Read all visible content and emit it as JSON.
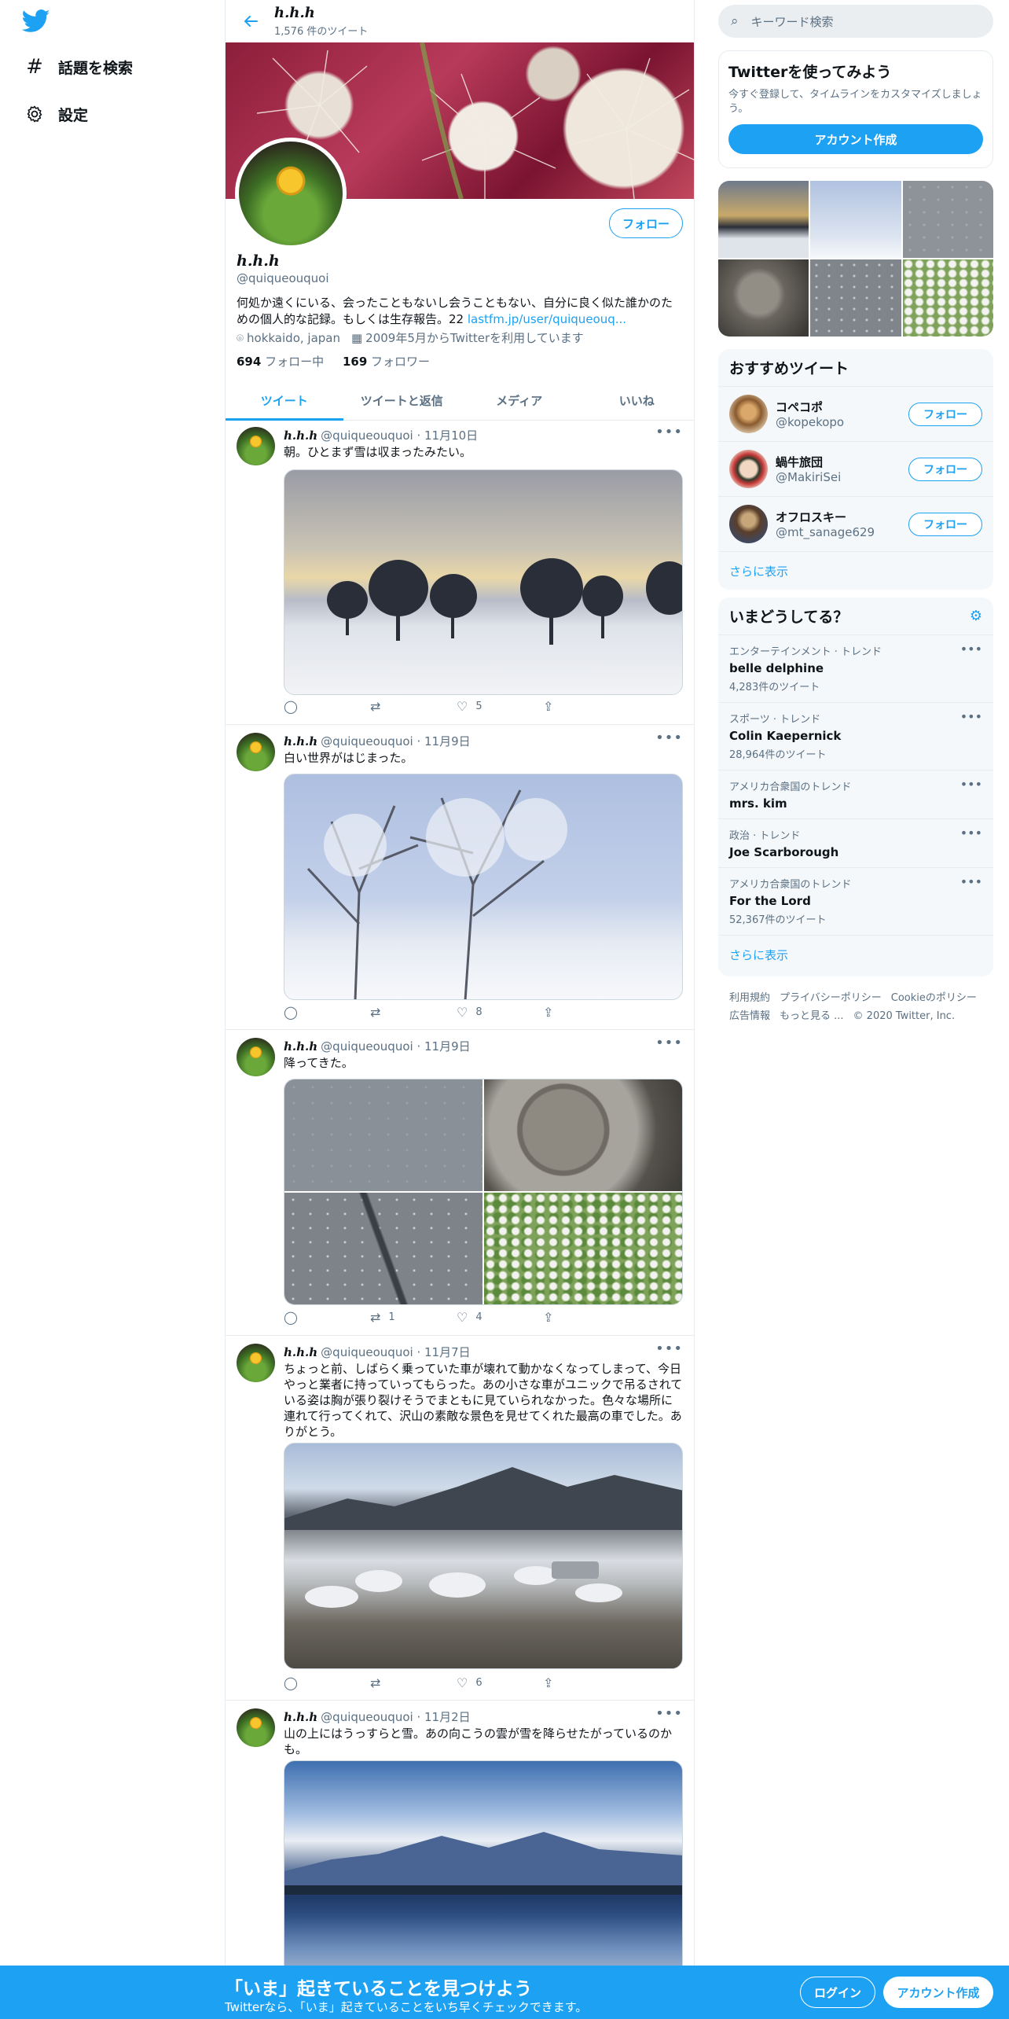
{
  "nav": {
    "explore_label": "話題を検索",
    "settings_label": "設定"
  },
  "header": {
    "name": "ℎ.ℎ.ℎ",
    "tweet_count": "1,576 件のツイート"
  },
  "profile": {
    "name": "ℎ.ℎ.ℎ",
    "handle": "@quiqueouquoi",
    "follow_label": "フォロー",
    "bio": "何処か遠くにいる、会ったこともないし会うこともない、自分に良く似た誰かのための個人的な記録。もしくは生存報告。22 ",
    "bio_link": "lastfm.jp/user/quiqueouq...",
    "location": "hokkaido, japan",
    "joined": "2009年5月からTwitterを利用しています",
    "following_count": "694",
    "following_label": "フォロー中",
    "followers_count": "169",
    "followers_label": "フォロワー"
  },
  "tabs": [
    {
      "label": "ツイート"
    },
    {
      "label": "ツイートと返信"
    },
    {
      "label": "メディア"
    },
    {
      "label": "いいね"
    }
  ],
  "tweets": [
    {
      "name": "ℎ.ℎ.ℎ",
      "handle": "@quiqueouquoi",
      "date": "11月10日",
      "text": "朝。ひとまず雪は収まったみたい。",
      "retweets": "",
      "likes": "5"
    },
    {
      "name": "ℎ.ℎ.ℎ",
      "handle": "@quiqueouquoi",
      "date": "11月9日",
      "text": "白い世界がはじまった。",
      "retweets": "",
      "likes": "8"
    },
    {
      "name": "ℎ.ℎ.ℎ",
      "handle": "@quiqueouquoi",
      "date": "11月9日",
      "text": "降ってきた。",
      "retweets": "1",
      "likes": "4"
    },
    {
      "name": "ℎ.ℎ.ℎ",
      "handle": "@quiqueouquoi",
      "date": "11月7日",
      "text": "ちょっと前、しばらく乗っていた車が壊れて動かなくなってしまって、今日やっと業者に持っていってもらった。あの小さな車がユニックで吊るされている姿は胸が張り裂けそうでまともに見ていられなかった。色々な場所に連れて行ってくれて、沢山の素敵な景色を見せてくれた最高の車でした。ありがとう。",
      "retweets": "",
      "likes": "6"
    },
    {
      "name": "ℎ.ℎ.ℎ",
      "handle": "@quiqueouquoi",
      "date": "11月2日",
      "text": "山の上にはうっすらと雪。あの向こうの雲が雪を降らせたがっているのかも。",
      "retweets": "",
      "likes": ""
    }
  ],
  "right": {
    "search_placeholder": "キーワード検索",
    "signup": {
      "title": "Twitterを使ってみよう",
      "subtitle": "今すぐ登録して、タイムラインをカスタマイズしましょう。",
      "button": "アカウント作成"
    },
    "who_to_follow": {
      "title": "おすすめツイート",
      "users": [
        {
          "name": "コペコポ",
          "handle": "@kopekopo",
          "button": "フォロー"
        },
        {
          "name": "蝸牛旅団",
          "handle": "@MakiriSei",
          "button": "フォロー"
        },
        {
          "name": "オフロスキー",
          "handle": "@mt_sanage629",
          "button": "フォロー"
        }
      ],
      "more": "さらに表示"
    },
    "trends": {
      "title": "いまどうしてる？",
      "items": [
        {
          "category": "エンターテインメント · トレンド",
          "name": "belle delphine",
          "count": "4,283件のツイート"
        },
        {
          "category": "スポーツ · トレンド",
          "name": "Colin Kaepernick",
          "count": "28,964件のツイート"
        },
        {
          "category": "アメリカ合衆国のトレンド",
          "name": "mrs. kim",
          "count": ""
        },
        {
          "category": "政治 · トレンド",
          "name": "Joe Scarborough",
          "count": ""
        },
        {
          "category": "アメリカ合衆国のトレンド",
          "name": "For the Lord",
          "count": "52,367件のツイート"
        }
      ],
      "more": "さらに表示"
    },
    "footer": {
      "terms": "利用規約",
      "privacy": "プライバシーポリシー",
      "cookie": "Cookieのポリシー",
      "ads": "広告情報",
      "more": "もっと見る ...",
      "copyright": "© 2020 Twitter, Inc."
    }
  },
  "bottom": {
    "title": "「いま」起きていることを見つけよう",
    "subtitle": "Twitterなら、「いま」起きていることをいち早くチェックできます。",
    "login": "ログイン",
    "signup": "アカウント作成"
  },
  "colors": {
    "accent": "#1da1f2",
    "text": "#0f1419",
    "secondary": "#5b7083",
    "border": "#e6ecf0"
  }
}
